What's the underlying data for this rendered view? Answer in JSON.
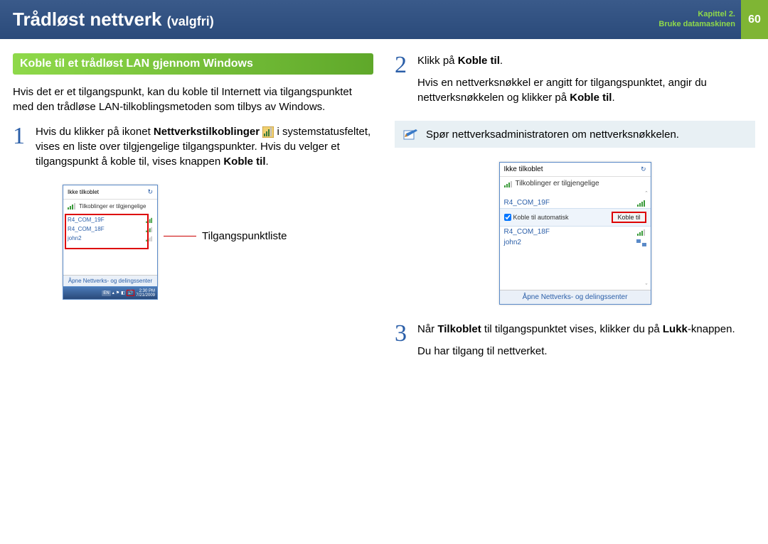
{
  "header": {
    "title": "Trådløst nettverk",
    "subtitle": "(valgfri)",
    "chapter_line1": "Kapittel 2.",
    "chapter_line2": "Bruke datamaskinen",
    "page_number": "60"
  },
  "left": {
    "section_heading": "Koble til et trådløst LAN gjennom Windows",
    "intro": "Hvis det er et tilgangspunkt, kan du koble til Internett via tilgangspunktet med den trådløse LAN-tilkoblingsmetoden som tilbys av Windows.",
    "step1_num": "1",
    "step1_a": "Hvis du klikker på ikonet ",
    "step1_bold": "Nettverkstilkoblinger",
    "step1_b": " i systemstatusfeltet, vises en liste over tilgjengelige tilgangspunkter. Hvis du velger et tilgangspunkt å koble til, vises knappen ",
    "step1_bold2": "Koble til",
    "step1_c": ".",
    "screenshot1": {
      "status": "Ikke tilkoblet",
      "available": "Tilkoblinger er tilgjengelige",
      "ap1": "R4_COM_19F",
      "ap2": "R4_COM_18F",
      "ap3": "john2",
      "footer": "Åpne Nettverks- og delingssenter",
      "label": "Tilgangspunktliste",
      "tb_lang": "EN",
      "tb_time": "2:30 PM",
      "tb_date": "7/21/2009"
    }
  },
  "right": {
    "step2_num": "2",
    "step2_a": "Klikk på ",
    "step2_bold": "Koble til",
    "step2_b": ".",
    "step2_p2a": "Hvis en nettverksnøkkel er angitt for tilgangspunktet, angir du nettverksnøkkelen og klikker på ",
    "step2_p2bold": "Koble til",
    "step2_p2b": ".",
    "note": "Spør nettverksadministratoren om nettverksnøkkelen.",
    "screenshot2": {
      "status": "Ikke tilkoblet",
      "available": "Tilkoblinger er tilgjengelige",
      "ap1": "R4_COM_19F",
      "auto": "Koble til automatisk",
      "btn": "Koble til",
      "ap2": "R4_COM_18F",
      "ap3": "john2",
      "footer": "Åpne Nettverks- og delingssenter"
    },
    "step3_num": "3",
    "step3_a": "Når ",
    "step3_bold1": "Tilkoblet",
    "step3_b": " til tilgangspunktet vises, klikker du på ",
    "step3_bold2": "Lukk",
    "step3_c": "-knappen.",
    "step3_p2": "Du har tilgang til nettverket."
  }
}
